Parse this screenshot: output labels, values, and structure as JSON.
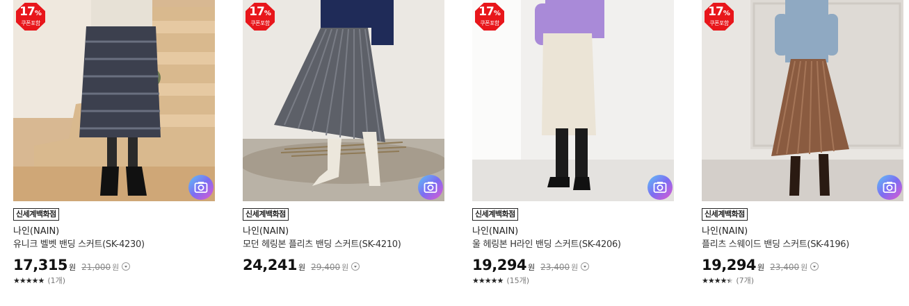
{
  "products": [
    {
      "coupon_percent": "17",
      "coupon_sign": "%",
      "coupon_label": "쿠폰포함",
      "store": "신세계백화점",
      "brand": "나인(NAIN)",
      "name": "유니크 벨벳 밴딩 스커트(SK-4230)",
      "price": "17,315",
      "price_unit": "원",
      "original_price": "21,000",
      "original_unit": "원",
      "rating": 5,
      "stars": "★★★★★",
      "review_count": "(1개)",
      "photo_icon": "camera-icon"
    },
    {
      "coupon_percent": "17",
      "coupon_sign": "%",
      "coupon_label": "쿠폰포함",
      "store": "신세계백화점",
      "brand": "나인(NAIN)",
      "name": "모던 헤링본 플리츠 밴딩 스커트(SK-4210)",
      "price": "24,241",
      "price_unit": "원",
      "original_price": "29,400",
      "original_unit": "원",
      "photo_icon": "camera-icon"
    },
    {
      "coupon_percent": "17",
      "coupon_sign": "%",
      "coupon_label": "쿠폰포함",
      "store": "신세계백화점",
      "brand": "나인(NAIN)",
      "name": "울 헤링본 H라인 밴딩 스커트(SK-4206)",
      "price": "19,294",
      "price_unit": "원",
      "original_price": "23,400",
      "original_unit": "원",
      "rating": 5,
      "stars": "★★★★★",
      "review_count": "(15개)",
      "photo_icon": "camera-icon"
    },
    {
      "coupon_percent": "17",
      "coupon_sign": "%",
      "coupon_label": "쿠폰포함",
      "store": "신세계백화점",
      "brand": "나인(NAIN)",
      "name": "플리츠 스웨이드 밴딩 스커트(SK-4196)",
      "price": "19,294",
      "price_unit": "원",
      "original_price": "23,400",
      "original_unit": "원",
      "rating": 4.5,
      "stars": "★★★★★",
      "review_count": "(7개)",
      "photo_icon": "camera-icon"
    }
  ],
  "colors": {
    "coupon_badge": "#e8161b",
    "camera_gradient_start": "#5ec3f6",
    "camera_gradient_end": "#e05ad0"
  }
}
